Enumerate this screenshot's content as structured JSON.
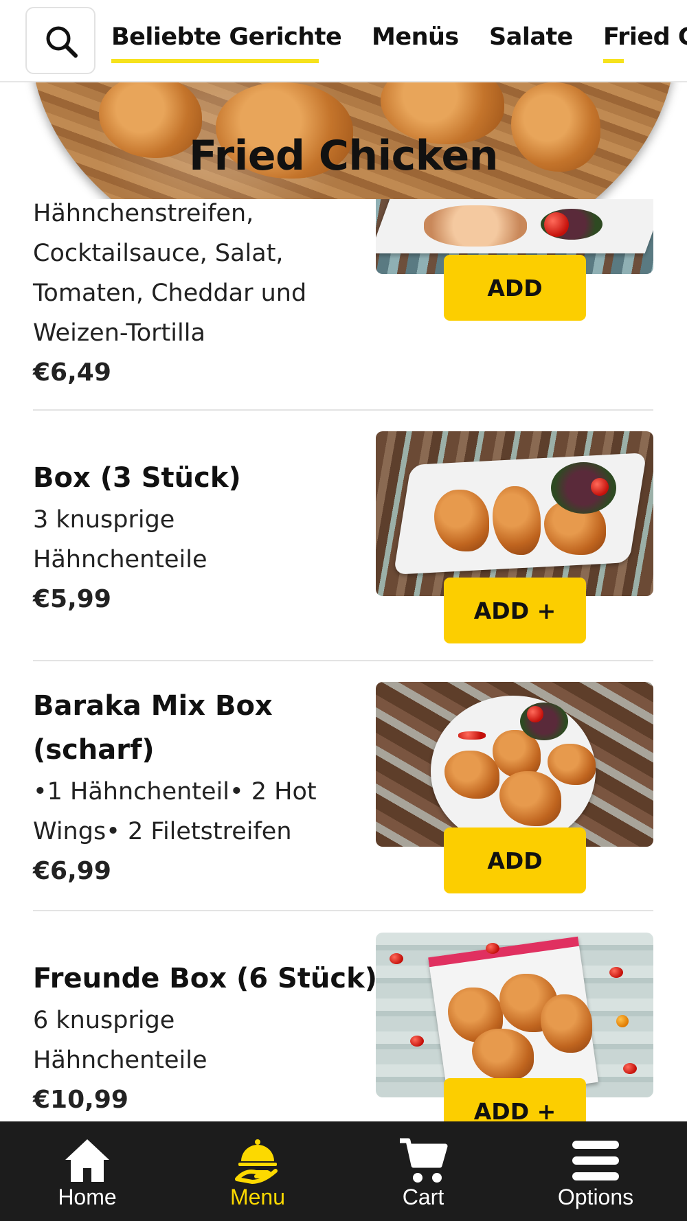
{
  "tabs": [
    {
      "label": "Beliebte Gerichte",
      "active": true
    },
    {
      "label": "Menüs",
      "active": false
    },
    {
      "label": "Salate",
      "active": false
    },
    {
      "label": "Fried Chicken",
      "active": true
    }
  ],
  "section": {
    "title": "Fried Chicken"
  },
  "items": [
    {
      "name": "",
      "description_lines": [
        "Hähnchenstreifen,",
        "Cocktailsauce, Salat,",
        "Tomaten, Cheddar und",
        "Weizen-Tortilla"
      ],
      "price": "€6,49",
      "button": "ADD"
    },
    {
      "name": "Box (3 Stück)",
      "description_lines": [
        "3 knusprige",
        "Hähnchenteile"
      ],
      "price": "€5,99",
      "button": "ADD +"
    },
    {
      "name_lines": [
        "Baraka Mix Box",
        "(scharf)"
      ],
      "description_lines": [
        "•1 Hähnchenteil• 2 Hot",
        "Wings• 2 Filetstreifen"
      ],
      "price": "€6,99",
      "button": "ADD"
    },
    {
      "name": "Freunde Box (6 Stück)",
      "description_lines": [
        "6 knusprige",
        "Hähnchenteile"
      ],
      "price": "€10,99",
      "button": "ADD +"
    }
  ],
  "bottom_nav": [
    {
      "label": "Home",
      "icon": "home-icon",
      "active": false
    },
    {
      "label": "Menu",
      "icon": "cloche-icon",
      "active": true
    },
    {
      "label": "Cart",
      "icon": "cart-icon",
      "active": false
    },
    {
      "label": "Options",
      "icon": "hamburger-menu-icon",
      "active": false
    }
  ],
  "colors": {
    "accent_yellow": "#fcce00",
    "tab_underline": "#f6e21c",
    "nav_background": "#1c1c1c",
    "active_nav": "#fcd900"
  }
}
